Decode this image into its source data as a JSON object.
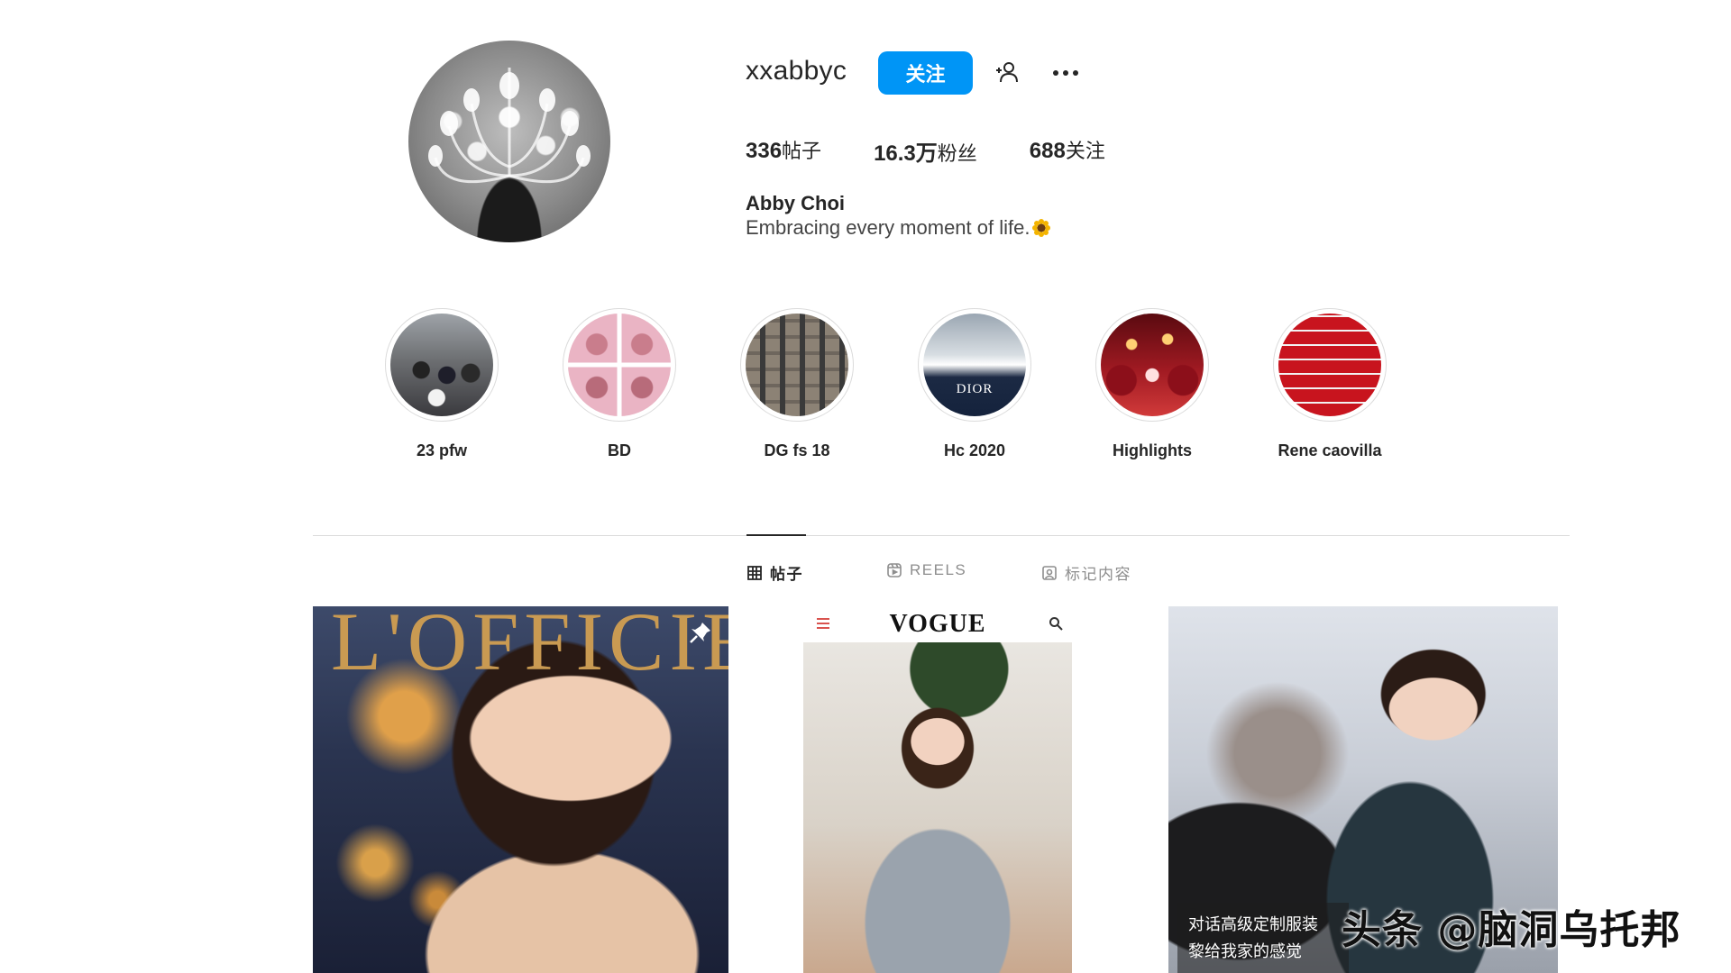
{
  "profile": {
    "username": "xxabbyc",
    "follow_label": "关注",
    "stats": {
      "posts_count": "336",
      "posts_label": "帖子",
      "followers_count": "16.3万",
      "followers_label": "粉丝",
      "following_count": "688",
      "following_label": "关注"
    },
    "full_name": "Abby Choi",
    "bio": "Embracing every moment of life."
  },
  "highlights": [
    {
      "label": "23 pfw"
    },
    {
      "label": "BD"
    },
    {
      "label": "DG fs 18"
    },
    {
      "label": "Hc 2020"
    },
    {
      "label": "Highlights"
    },
    {
      "label": "Rene caovilla"
    }
  ],
  "tabs": [
    {
      "label": "帖子",
      "icon": "grid-icon",
      "active": true
    },
    {
      "label": "REELS",
      "icon": "reels-icon",
      "active": false
    },
    {
      "label": "标记内容",
      "icon": "tagged-icon",
      "active": false
    }
  ],
  "posts": [
    {
      "magazine_title": "L'OFFICIEL"
    },
    {
      "magazine_title": "VOGUE"
    },
    {
      "caption_line1": "对话高级定制服装",
      "caption_line2": "黎给我家的感觉"
    }
  ],
  "watermark": "头条 @脑洞乌托邦",
  "colors": {
    "accent": "#0095f6",
    "text": "#262626",
    "muted": "#8e8e8e",
    "divider": "#dbdbdb"
  }
}
